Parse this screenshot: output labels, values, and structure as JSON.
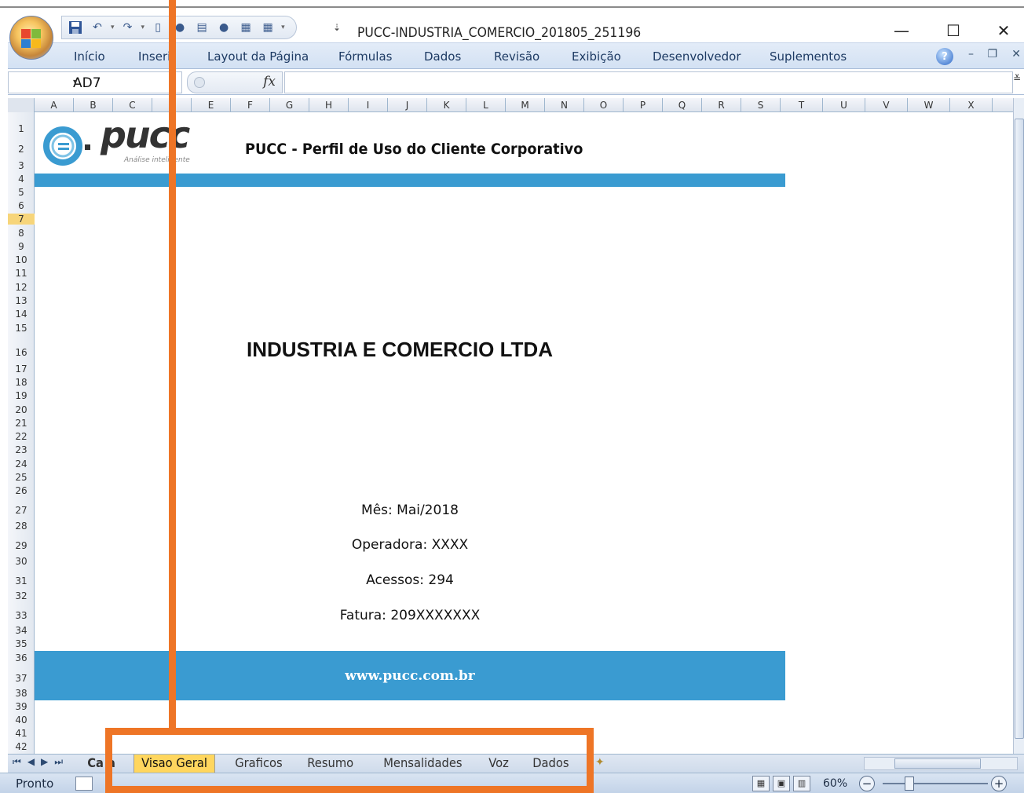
{
  "window": {
    "title": "PUCC-INDUSTRIA_COMERCIO_201805_251196",
    "minimize": "—",
    "maximize": "☐",
    "close": "✕"
  },
  "quick_access": {
    "more": "⇣"
  },
  "ribbon": {
    "tabs": [
      "Início",
      "Inseri",
      "Layout da Página",
      "Fórmulas",
      "Dados",
      "Revisão",
      "Exibição",
      "Desenvolvedor",
      "Suplementos"
    ],
    "help": "?"
  },
  "formula_bar": {
    "name_box": "AD7",
    "fx": "fx",
    "value": ""
  },
  "columns": [
    "A",
    "B",
    "C",
    "",
    "E",
    "F",
    "G",
    "H",
    "I",
    "J",
    "K",
    "L",
    "M",
    "N",
    "O",
    "P",
    "Q",
    "R",
    "S",
    "T",
    "U",
    "V",
    "W",
    "X"
  ],
  "rows": [
    "1",
    "2",
    "3",
    "4",
    "5",
    "6",
    "7",
    "8",
    "9",
    "10",
    "11",
    "12",
    "13",
    "14",
    "15",
    "16",
    "17",
    "18",
    "19",
    "20",
    "21",
    "22",
    "23",
    "24",
    "25",
    "26",
    "27",
    "28",
    "29",
    "30",
    "31",
    "32",
    "33",
    "34",
    "35",
    "36",
    "37",
    "38",
    "39",
    "40",
    "41",
    "42"
  ],
  "selected_row": "7",
  "sheet": {
    "logo_text": "pucc",
    "logo_tagline": "Análise inteligente",
    "header_title": "PUCC - Perfil de Uso do Cliente Corporativo",
    "company": "INDUSTRIA E COMERCIO LTDA",
    "month": "Mês: Mai/2018",
    "operator": "Operadora: XXXX",
    "accesses": "Acessos: 294",
    "invoice": "Fatura: 209XXXXXXX",
    "website": "www.pucc.com.br"
  },
  "sheet_tabs": [
    "Ca a",
    "Visao Geral",
    "Graficos",
    "Resumo",
    "Mensalidades",
    "Voz",
    "Dados"
  ],
  "active_sheet_tab": "Visao Geral",
  "status": {
    "text": "Pronto",
    "zoom": "60%"
  },
  "colors": {
    "band": "#3a9bd1",
    "annotation": "#ee7526",
    "active_tab": "#ffd65e"
  }
}
